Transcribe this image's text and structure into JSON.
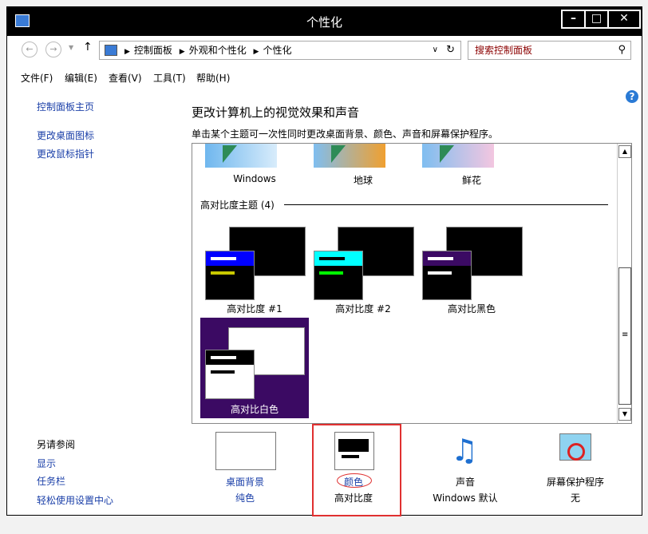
{
  "window": {
    "title": "个性化"
  },
  "address": {
    "crumbs": [
      "控制面板",
      "外观和个性化",
      "个性化"
    ],
    "search_placeholder": "搜索控制面板"
  },
  "menu": [
    "文件(F)",
    "编辑(E)",
    "查看(V)",
    "工具(T)",
    "帮助(H)"
  ],
  "sidebar": {
    "links": [
      "控制面板主页",
      "更改桌面图标",
      "更改鼠标指针"
    ],
    "see_also": "另请参阅",
    "see_also_links": [
      "显示",
      "任务栏",
      "轻松使用设置中心"
    ]
  },
  "main": {
    "heading": "更改计算机上的视觉效果和声音",
    "description": "单击某个主题可一次性同时更改桌面背景、颜色、声音和屏幕保护程序。"
  },
  "themes": {
    "top_row": [
      "Windows",
      "地球",
      "鲜花"
    ],
    "hc_group": "高对比度主题 (4)",
    "hc": [
      "高对比度 #1",
      "高对比度 #2",
      "高对比黑色",
      "高对比白色"
    ]
  },
  "bottom": [
    {
      "title": "桌面背景",
      "value": "纯色"
    },
    {
      "title": "颜色",
      "value": "高对比度"
    },
    {
      "title": "声音",
      "value": "Windows 默认"
    },
    {
      "title": "屏幕保护程序",
      "value": "无"
    }
  ],
  "colors": {
    "accent": "#1a3fa8",
    "selected_theme": "#3b0a63",
    "highlight_box": "#e03030"
  }
}
